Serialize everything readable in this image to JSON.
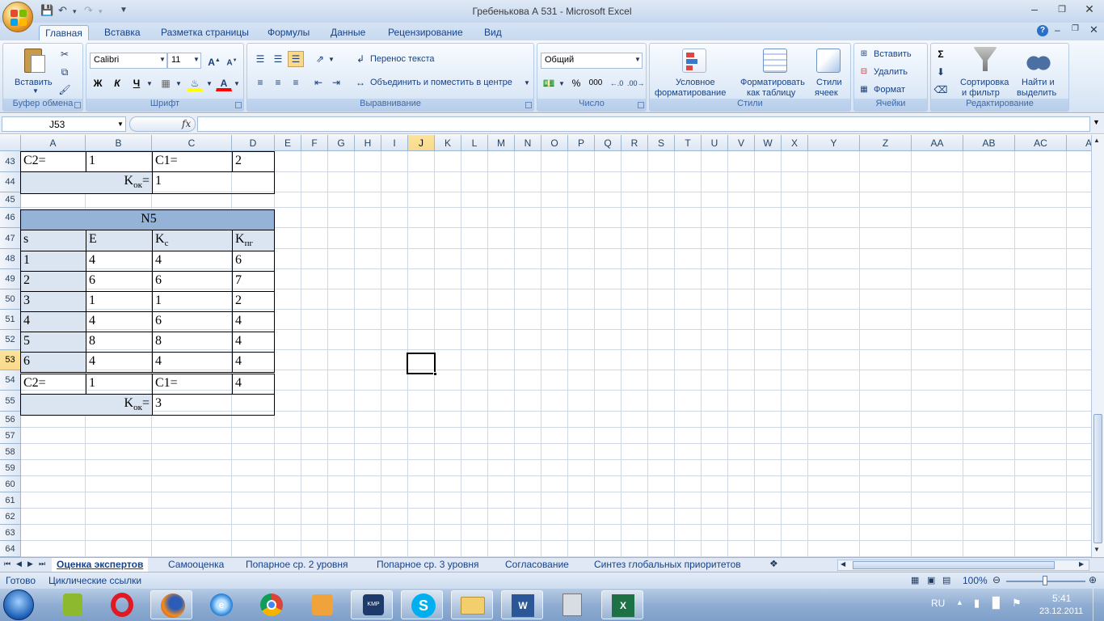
{
  "window": {
    "title": "Гребенькова А 531 - Microsoft Excel"
  },
  "tabs": [
    "Главная",
    "Вставка",
    "Разметка страницы",
    "Формулы",
    "Данные",
    "Рецензирование",
    "Вид"
  ],
  "ribbon": {
    "clipboard": {
      "paste": "Вставить",
      "label": "Буфер обмена"
    },
    "font": {
      "name": "Calibri",
      "size": "11",
      "bold": "Ж",
      "italic": "К",
      "underline": "Ч",
      "label": "Шрифт"
    },
    "alignment": {
      "wrap": "Перенос текста",
      "merge": "Объединить и поместить в центре",
      "label": "Выравнивание"
    },
    "number": {
      "format": "Общий",
      "percent": "%",
      "thousands": "000",
      "label": "Число"
    },
    "styles": {
      "conditional": "Условное",
      "conditional2": "форматирование",
      "table": "Форматировать",
      "table2": "как таблицу",
      "cell": "Стили",
      "cell2": "ячеек",
      "label": "Стили"
    },
    "cells": {
      "insert": "Вставить",
      "delete": "Удалить",
      "format": "Формат",
      "label": "Ячейки"
    },
    "editing": {
      "sort": "Сортировка",
      "sort2": "и фильтр",
      "find": "Найти и",
      "find2": "выделить",
      "label": "Редактирование"
    }
  },
  "formula_bar": {
    "name_box": "J53",
    "fx": "fx",
    "value": ""
  },
  "columns": [
    "A",
    "B",
    "C",
    "D",
    "E",
    "F",
    "G",
    "H",
    "I",
    "J",
    "K",
    "L",
    "M",
    "N",
    "O",
    "P",
    "Q",
    "R",
    "S",
    "T",
    "U",
    "V",
    "W",
    "X",
    "Y",
    "Z",
    "AA",
    "AB",
    "AC",
    "AD"
  ],
  "rows": [
    "43",
    "44",
    "45",
    "46",
    "47",
    "48",
    "49",
    "50",
    "51",
    "52",
    "53",
    "54",
    "55",
    "56",
    "57",
    "58",
    "59",
    "60",
    "61",
    "62",
    "63",
    "64"
  ],
  "sheet": {
    "r43": [
      "C2=",
      "1",
      "C1=",
      "2"
    ],
    "r44": {
      "label": "K",
      "sub": "ок",
      "eq": "=",
      "value": "1"
    },
    "r46": "N5",
    "r47": {
      "a": "s",
      "b": "E",
      "c": "K",
      "c_sub": "c",
      "d": "K",
      "d_sub": "пг"
    },
    "data": [
      [
        "1",
        "4",
        "4",
        "6"
      ],
      [
        "2",
        "6",
        "6",
        "7"
      ],
      [
        "3",
        "1",
        "1",
        "2"
      ],
      [
        "4",
        "4",
        "6",
        "4"
      ],
      [
        "5",
        "8",
        "8",
        "4"
      ],
      [
        "6",
        "4",
        "4",
        "4"
      ]
    ],
    "r54": [
      "C2=",
      "1",
      "C1=",
      "4"
    ],
    "r55": {
      "label": "K",
      "sub": "ок",
      "eq": "=",
      "value": "3"
    }
  },
  "sheet_tabs": [
    "Оценка экспертов",
    "Самооценка",
    "Попарное ср. 2 уровня",
    "Попарное ср. 3 уровня",
    "Согласование",
    "Синтез глобальных приоритетов"
  ],
  "status": {
    "ready": "Готово",
    "circular": "Циклические ссылки",
    "zoom": "100%"
  },
  "taskbar": {
    "lang": "RU",
    "time": "5:41",
    "date": "23.12.2011"
  }
}
